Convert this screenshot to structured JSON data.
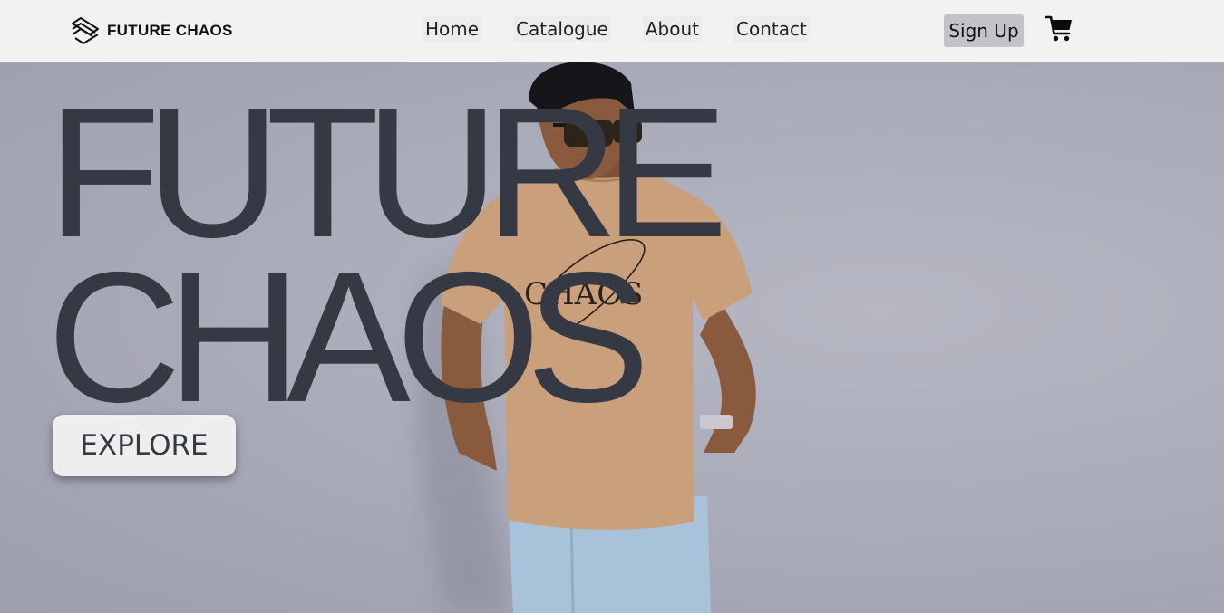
{
  "navbar": {
    "brand_name": "FUTURE CHAOS",
    "brand_icon": "logo-icon",
    "links": [
      {
        "label": "Home"
      },
      {
        "label": "Catalogue"
      },
      {
        "label": "About"
      },
      {
        "label": "Contact"
      }
    ],
    "signup_label": "Sign Up",
    "cart_icon": "cart-icon"
  },
  "hero": {
    "title_line1": "FUTURE",
    "title_line2": "CHAOS",
    "explore_label": "EXPLORE",
    "shirt_print": "CHAOS"
  },
  "colors": {
    "navbar_bg": "#f2f2f2",
    "hero_bg": "#a9aab8",
    "title_text": "#353943",
    "signup_bg": "#c1c3c7",
    "explore_bg": "#eeeeef",
    "shirt": "#c99f7c",
    "jeans": "#a8c2da"
  }
}
